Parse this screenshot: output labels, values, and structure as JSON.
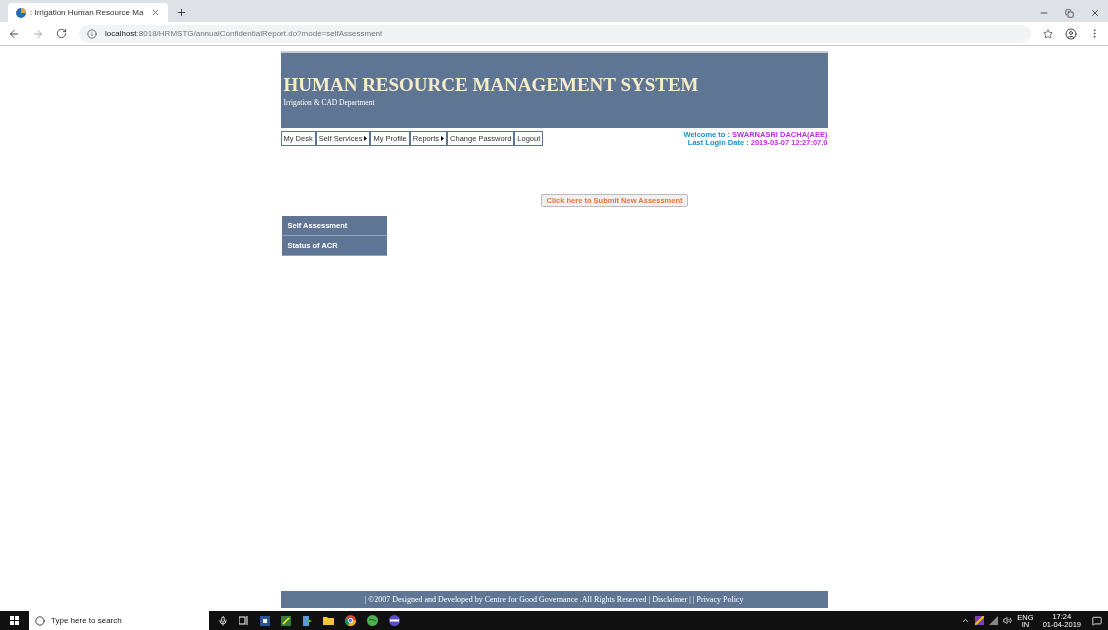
{
  "browser": {
    "tab_title": ": Irrigation Human Resource Ma",
    "url_host": "localhost",
    "url_rest": ":8018/HRMSTG/annualConfidentialReport.do?mode=selfAssessment"
  },
  "header": {
    "title": "HUMAN RESOURCE MANAGEMENT SYSTEM",
    "subtitle": "Irrigation & CAD Department"
  },
  "menu": [
    {
      "label": "My Desk",
      "has_submenu": false
    },
    {
      "label": "Self Services",
      "has_submenu": true
    },
    {
      "label": "My Profile",
      "has_submenu": false
    },
    {
      "label": "Reports",
      "has_submenu": true
    },
    {
      "label": "Change Password",
      "has_submenu": false
    },
    {
      "label": "Logout",
      "has_submenu": false
    }
  ],
  "user": {
    "welcome_label": "Welcome to : ",
    "welcome_name": "SWARNASRI DACHA(AEE)",
    "login_label": "Last Login Date : ",
    "login_date": "2019-03-07 12:27:07.0"
  },
  "submit_button": "Click here to Submit New Assessment",
  "side_menu": [
    "Self Assessment",
    "Status of ACR"
  ],
  "footer": {
    "text": "| ©2007 Designed and Developed by Centre for Good Governance .All Rights Reserved | ",
    "links": [
      "Disclaimer",
      "Privacy Policy"
    ],
    "separator": " | | "
  },
  "taskbar": {
    "search_placeholder": "Type here to search",
    "lang": "ENG",
    "region": "IN",
    "time": "17:24",
    "date": "01-04-2019"
  }
}
